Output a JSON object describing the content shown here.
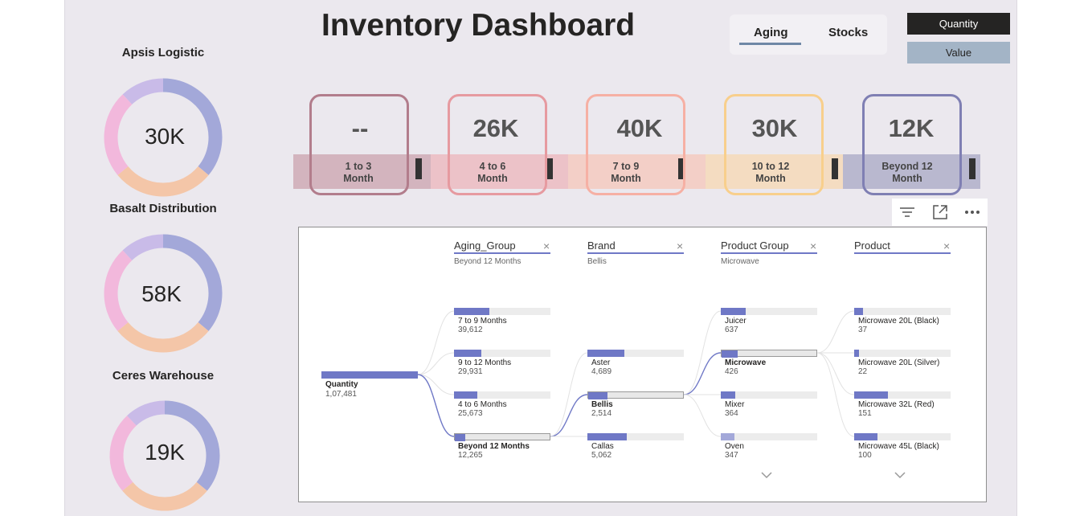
{
  "header": {
    "title": "Inventory Dashboard"
  },
  "tabs": [
    {
      "label": "Aging"
    },
    {
      "label": "Stocks"
    }
  ],
  "buttons": {
    "quantity": "Quantity",
    "value": "Value"
  },
  "warehouses": [
    {
      "name": "Apsis Logistic",
      "value": "30K"
    },
    {
      "name": "Basalt Distribution",
      "value": "58K"
    },
    {
      "name": "Ceres Warehouse",
      "value": "19K"
    }
  ],
  "donut_colors": [
    "#a3a8d9",
    "#f4c6a8",
    "#f2b8dc",
    "#c9bbe8"
  ],
  "aging_cards": [
    {
      "value": "--",
      "label_1": "1 to 3",
      "label_2": "Month",
      "border": "#b27d8c",
      "fill": "#d3b4be"
    },
    {
      "value": "26K",
      "label_1": "4 to 6",
      "label_2": "Month",
      "border": "#e69aa0",
      "fill": "#ecc2c8"
    },
    {
      "value": "40K",
      "label_1": "7 to 9",
      "label_2": "Month",
      "border": "#f6b0a4",
      "fill": "#f3cfc7"
    },
    {
      "value": "30K",
      "label_1": "10 to 12",
      "label_2": "Month",
      "border": "#f8cf8c",
      "fill": "#f4dcc1"
    },
    {
      "value": "12K",
      "label_1": "Beyond 12",
      "label_2": "Month",
      "border": "#7f7fb3",
      "fill": "#b9b8cf"
    }
  ],
  "toolbar": {
    "filter": "filter-icon",
    "focus": "focus-mode-icon",
    "more": "more-options-icon"
  },
  "tree": {
    "root": {
      "name": "Quantity",
      "value": "1,07,481"
    },
    "columns": [
      {
        "header": "Aging_Group",
        "filter": "Beyond 12 Months"
      },
      {
        "header": "Brand",
        "filter": "Bellis"
      },
      {
        "header": "Product Group",
        "filter": "Microwave"
      },
      {
        "header": "Product",
        "filter": ""
      }
    ],
    "aging": [
      {
        "name": "7 to 9 Months",
        "value": "39,612",
        "fill": 0.37,
        "selected": false
      },
      {
        "name": "9 to 12 Months",
        "value": "29,931",
        "fill": 0.28,
        "selected": false
      },
      {
        "name": "4 to 6 Months",
        "value": "25,673",
        "fill": 0.24,
        "selected": false
      },
      {
        "name": "Beyond 12 Months",
        "value": "12,265",
        "fill": 0.11,
        "selected": true
      }
    ],
    "brand": [
      {
        "name": "Aster",
        "value": "4,689",
        "fill": 0.38,
        "selected": false
      },
      {
        "name": "Bellis",
        "value": "2,514",
        "fill": 0.2,
        "selected": true
      },
      {
        "name": "Callas",
        "value": "5,062",
        "fill": 0.41,
        "selected": false
      }
    ],
    "product_group": [
      {
        "name": "Juicer",
        "value": "637",
        "fill": 0.26,
        "selected": false
      },
      {
        "name": "Microwave",
        "value": "426",
        "fill": 0.17,
        "selected": true
      },
      {
        "name": "Mixer",
        "value": "364",
        "fill": 0.15,
        "selected": false
      },
      {
        "name": "Oven",
        "value": "347",
        "fill": 0.14,
        "selected": false
      }
    ],
    "product": [
      {
        "name": "Microwave 20L (Black)",
        "value": "37",
        "fill": 0.09
      },
      {
        "name": "Microwave 20L (Silver)",
        "value": "22",
        "fill": 0.05
      },
      {
        "name": "Microwave 32L (Red)",
        "value": "151",
        "fill": 0.35
      },
      {
        "name": "Microwave 45L (Black)",
        "value": "100",
        "fill": 0.24
      }
    ]
  }
}
